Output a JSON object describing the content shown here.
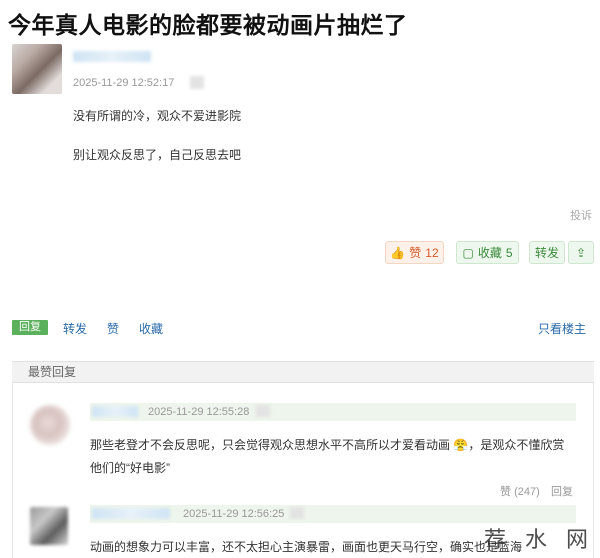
{
  "post": {
    "title": "今年真人电影的脸都要被动画片抽烂了",
    "timestamp": "2025-11-29 12:52:17",
    "lines": [
      "没有所谓的冷，观众不爱进影院",
      "别让观众反思了，自己反思去吧"
    ],
    "report_label": "投诉",
    "like_label": "赞",
    "like_count": "12",
    "fav_label": "收藏",
    "fav_count": "5",
    "forward_label": "转发",
    "share_icon": "share-icon"
  },
  "toolbar": {
    "reply": "回复",
    "forward": "转发",
    "like": "赞",
    "favorite": "收藏",
    "view_author": "只看楼主"
  },
  "section": {
    "title": "最赞回复"
  },
  "replies": [
    {
      "timestamp": "2025-11-29 12:55:28",
      "text_line1": "那些老登才不会反思呢，只会觉得观众思想水平不高所以才爱看动画",
      "emoji": "😤",
      "text_line1_tail": "，是观众不懂欣赏",
      "text_line2": "他们的“好电影”",
      "like_label": "赞",
      "like_count": "(247)",
      "reply_label": "回复"
    },
    {
      "timestamp": "2025-11-29 12:56:25",
      "text": "动画的想象力可以丰富，还不太担心主演暴雷，画面也更天马行空，确实也是蓝海"
    }
  ],
  "watermark": "荐 水 网",
  "colors": {
    "accent_green": "#5bb05b",
    "link_blue": "#2a6aa8",
    "like_orange": "#d45a2a"
  }
}
